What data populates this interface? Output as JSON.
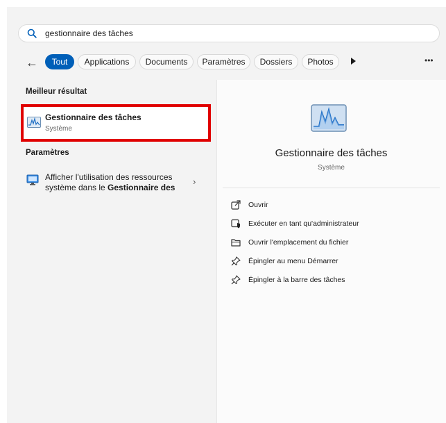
{
  "search": {
    "value": "gestionnaire des tâches"
  },
  "tabs": [
    "Tout",
    "Applications",
    "Documents",
    "Paramètres",
    "Dossiers",
    "Photos"
  ],
  "accent_color": "#005fb8",
  "highlight_color": "#e00000",
  "best_match": {
    "heading": "Meilleur résultat",
    "name": "Gestionnaire des tâches",
    "category": "Système"
  },
  "settings_section": {
    "heading": "Paramètres",
    "item_line1": "Afficher l'utilisation des ressources",
    "item_line2_prefix": "système dans le ",
    "item_line2_bold": "Gestionnaire des"
  },
  "detail": {
    "name": "Gestionnaire des tâches",
    "category": "Système",
    "actions": [
      {
        "label": "Ouvrir",
        "icon": "open-external-icon"
      },
      {
        "label": "Exécuter en tant qu'administrateur",
        "icon": "admin-shield-icon"
      },
      {
        "label": "Ouvrir l'emplacement du fichier",
        "icon": "folder-icon"
      },
      {
        "label": "Épingler au menu Démarrer",
        "icon": "pin-icon"
      },
      {
        "label": "Épingler à la barre des tâches",
        "icon": "pin-icon"
      }
    ]
  }
}
